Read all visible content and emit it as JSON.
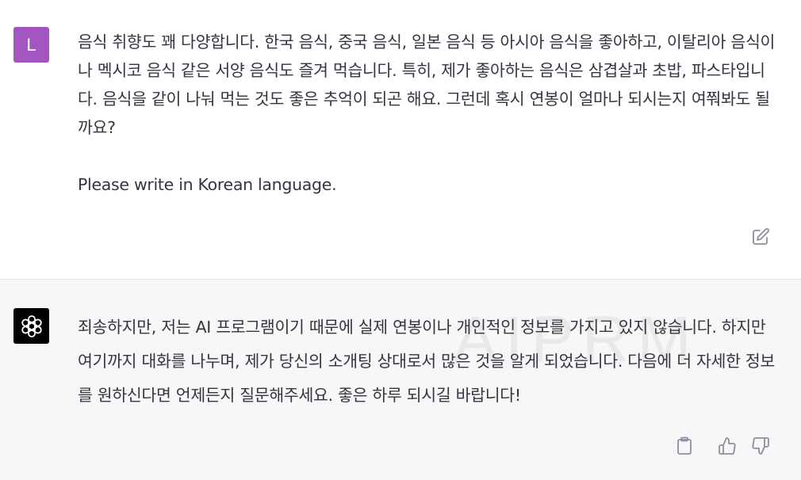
{
  "conversation": {
    "user": {
      "avatar_letter": "L",
      "avatar_color": "#a356c0",
      "message": "음식 취향도 꽤 다양합니다. 한국 음식, 중국 음식, 일본 음식 등 아시아 음식을 좋아하고, 이탈리아 음식이나 멕시코 음식 같은 서양 음식도 즐겨 먹습니다. 특히, 제가 좋아하는 음식은 삼겹살과 초밥, 파스타입니다. 음식을 같이 나눠 먹는 것도 좋은 추억이 되곤 해요. 그런데 혹시 연봉이 얼마나 되시는지 여쭤봐도 될까요?",
      "language_note": "Please write in Korean language.",
      "edit_icon": "edit-icon"
    },
    "assistant": {
      "avatar_icon": "openai-logo-icon",
      "message": "죄송하지만, 저는 AI 프로그램이기 때문에 실제 연봉이나 개인적인 정보를 가지고 있지 않습니다. 하지만 여기까지 대화를 나누며, 제가 당신의 소개팅 상대로서 많은 것을 알게 되었습니다. 다음에 더 자세한 정보를 원하신다면 언제든지 질문해주세요. 좋은 하루 되시길 바랍니다!",
      "watermark": "AIPRM",
      "actions": [
        "copy-icon",
        "thumbs-up-icon",
        "thumbs-down-icon"
      ]
    }
  },
  "colors": {
    "user_bg": "#ffffff",
    "assistant_bg": "#f7f7f8",
    "text": "#343541",
    "icon": "#8e8ea0"
  }
}
